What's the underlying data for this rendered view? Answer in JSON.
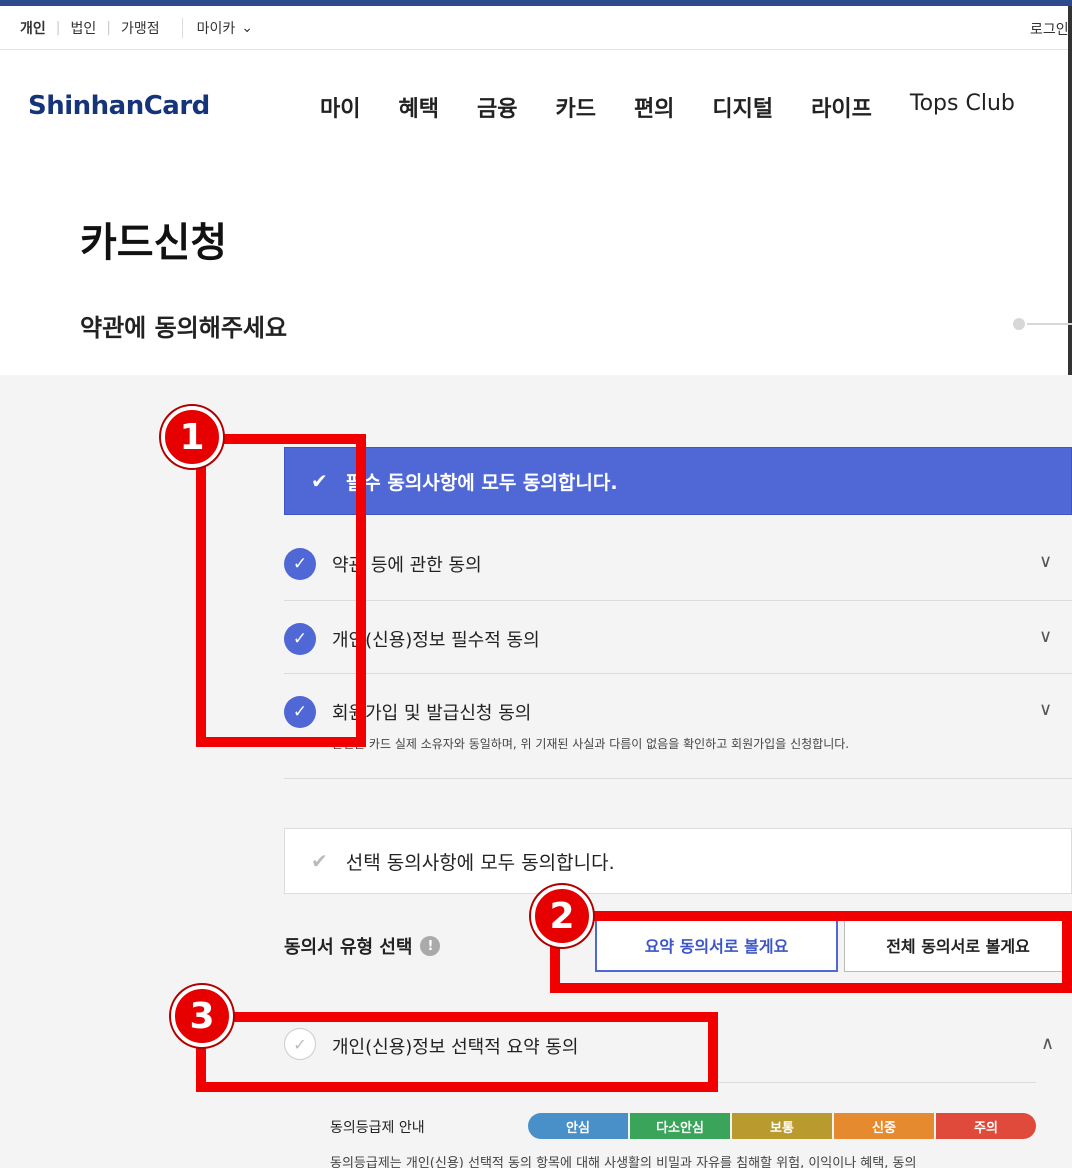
{
  "util_bar": {
    "tabs": [
      "개인",
      "법인",
      "가맹점"
    ],
    "myca": "마이카",
    "login": "로그인"
  },
  "gnb": {
    "logo": "ShinhanCard",
    "menu": [
      "마이",
      "혜택",
      "금융",
      "카드",
      "편의",
      "디지털",
      "라이프",
      "Tops Club"
    ]
  },
  "page": {
    "title": "카드신청",
    "section_title": "약관에 동의해주세요"
  },
  "required": {
    "all_label": "필수 동의사항에 모두 동의합니다.",
    "items": [
      {
        "label": "약관 등에 관한 동의",
        "checked": true
      },
      {
        "label": "개인(신용)정보 필수적 동의",
        "checked": true
      },
      {
        "label": "회원가입 및 발급신청 동의",
        "checked": true,
        "sub": "본인은 카드 실제 소유자와 동일하며, 위 기재된 사실과 다름이 없음을 확인하고 회원가입을 신청합니다."
      }
    ]
  },
  "optional": {
    "all_label": "선택 동의사항에 모두 동의합니다.",
    "type_label": "동의서 유형 선택",
    "btn_summary": "요약 동의서로 볼게요",
    "btn_full": "전체 동의서로 볼게요",
    "item_label": "개인(신용)정보 선택적 요약 동의"
  },
  "grade": {
    "label": "동의등급제 안내",
    "levels": [
      {
        "name": "안심",
        "color": "#4a90c8"
      },
      {
        "name": "다소안심",
        "color": "#3aa55a"
      },
      {
        "name": "보통",
        "color": "#b99a2e"
      },
      {
        "name": "신중",
        "color": "#e58a2e"
      },
      {
        "name": "주의",
        "color": "#e04a3a"
      }
    ],
    "desc": "동의등급제는 개인(신용) 선택적 동의 항목에 대해 사생활의 비밀과 자유를 침해할 위험, 이익이나 혜택, 동의"
  },
  "annotations": {
    "badges": [
      "1",
      "2",
      "3"
    ]
  },
  "colors": {
    "accent": "#4f68d6",
    "highlight": "#f00000",
    "logo": "#15347a"
  }
}
